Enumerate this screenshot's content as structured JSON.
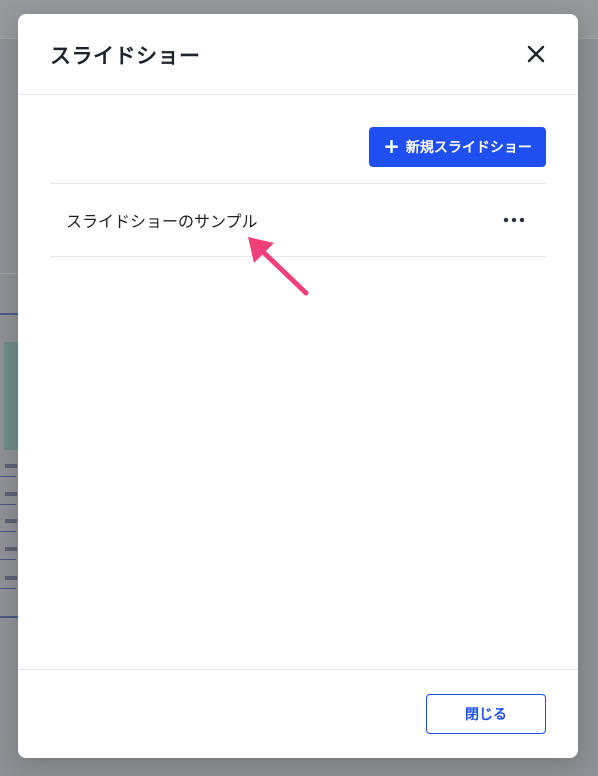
{
  "modal": {
    "title": "スライドショー",
    "close_icon": "close-icon",
    "new_button_label": "新規スライドショー",
    "new_button_icon": "plus-icon",
    "items": [
      {
        "title": "スライドショーのサンプル",
        "menu_icon": "more-horizontal-icon"
      }
    ],
    "footer_close_label": "閉じる"
  },
  "colors": {
    "accent": "#1f4ff0",
    "annotation_arrow": "#f0407a",
    "overlay": "#8f9095"
  }
}
